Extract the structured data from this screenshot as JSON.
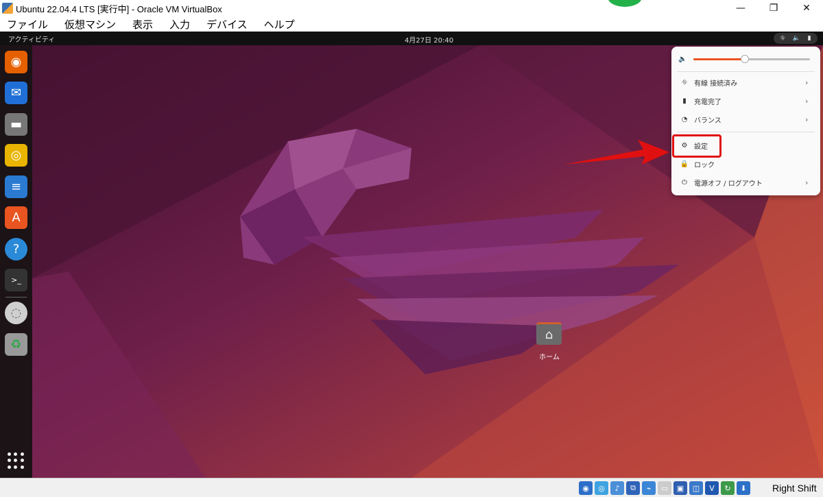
{
  "window": {
    "title": "Ubuntu 22.04.4 LTS [実行中] - Oracle VM VirtualBox",
    "minimize": "—",
    "restore": "❐",
    "close": "✕"
  },
  "vbox_menu": [
    {
      "label": "ファイル"
    },
    {
      "label": "仮想マシン"
    },
    {
      "label": "表示"
    },
    {
      "label": "入力"
    },
    {
      "label": "デバイス"
    },
    {
      "label": "ヘルプ"
    }
  ],
  "topbar": {
    "activities": "アクティビティ",
    "clock": "4月27日  20:40",
    "tray_icons": [
      "network-icon",
      "volume-icon",
      "battery-icon"
    ]
  },
  "dock": {
    "items": [
      {
        "name": "firefox-icon",
        "glyph": "◉",
        "color": "#e66000"
      },
      {
        "name": "thunderbird-icon",
        "glyph": "✉",
        "color": "#1f6fd6"
      },
      {
        "name": "files-icon",
        "glyph": "▬",
        "color": "#777777"
      },
      {
        "name": "rhythmbox-icon",
        "glyph": "◎",
        "color": "#e8b400"
      },
      {
        "name": "libreoffice-writer-icon",
        "glyph": "≡",
        "color": "#2a7ad2"
      },
      {
        "name": "app-center-icon",
        "glyph": "A",
        "color": "#e95420"
      },
      {
        "name": "help-icon",
        "glyph": "?",
        "color": "#2b8ad8"
      },
      {
        "name": "terminal-icon",
        "glyph": ">_",
        "color": "#333333"
      },
      {
        "name": "optical-disc-icon",
        "glyph": "◌",
        "color": "#cfcfcf"
      },
      {
        "name": "trash-icon",
        "glyph": "♻",
        "color": "#999999"
      }
    ]
  },
  "desktop": {
    "home_label": "ホーム"
  },
  "system_menu": {
    "volume_level": 0.44,
    "items": [
      {
        "icon": "network-icon",
        "glyph": "⛗",
        "label": "有線 接続済み",
        "chevron": "›"
      },
      {
        "icon": "battery-icon",
        "glyph": "▮",
        "label": "充電完了",
        "chevron": "›"
      },
      {
        "icon": "power-profile-icon",
        "glyph": "◔",
        "label": "バランス",
        "chevron": "›"
      },
      {
        "icon": "settings-gear-icon",
        "glyph": "⚙",
        "label": "設定",
        "chevron": ""
      },
      {
        "icon": "lock-icon",
        "glyph": "🔒",
        "label": "ロック",
        "chevron": ""
      },
      {
        "icon": "power-icon",
        "glyph": "⏻",
        "label": "電源オフ / ログアウト",
        "chevron": "›"
      }
    ]
  },
  "statusbar": {
    "icons": [
      {
        "name": "hdd-activity-icon",
        "color": "#2c6fc9"
      },
      {
        "name": "optical-drive-icon",
        "color": "#3ea3e0"
      },
      {
        "name": "audio-icon",
        "color": "#4b8fd8"
      },
      {
        "name": "network-adapter-icon",
        "color": "#2f63b8"
      },
      {
        "name": "usb-icon",
        "color": "#3b86d6"
      },
      {
        "name": "shared-folders-icon",
        "color": "#cccccc"
      },
      {
        "name": "display-icon",
        "color": "#2f5fb0"
      },
      {
        "name": "recording-icon",
        "color": "#3a78c9"
      },
      {
        "name": "virtualization-icon",
        "color": "#2058b0"
      },
      {
        "name": "mouse-integration-icon",
        "color": "#3e9a4a"
      },
      {
        "name": "keyboard-capture-icon",
        "color": "#2d70c8"
      }
    ],
    "host_key": "Right Shift"
  }
}
